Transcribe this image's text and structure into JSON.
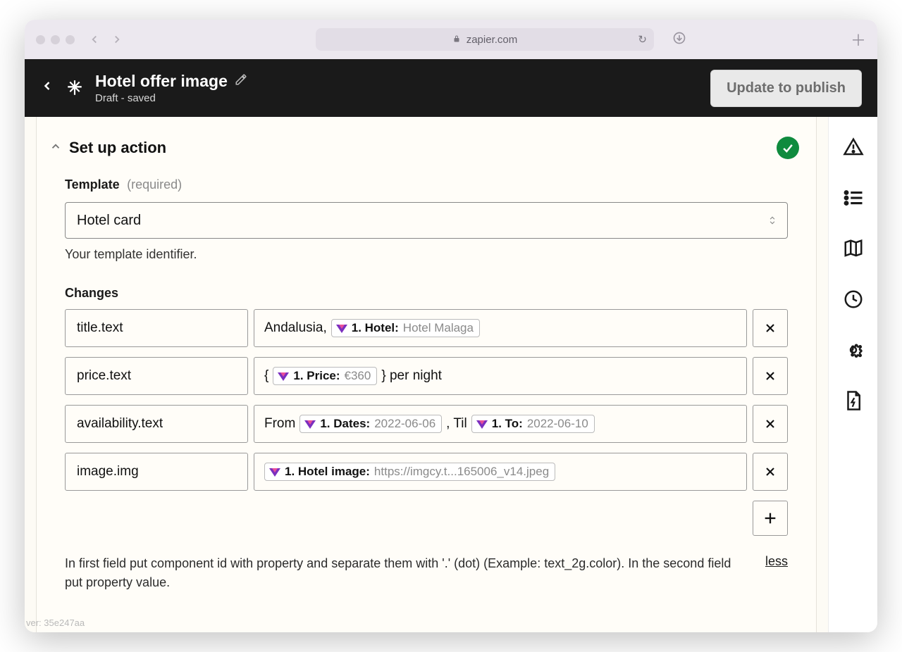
{
  "browser": {
    "domain": "zapier.com"
  },
  "header": {
    "title": "Hotel offer image",
    "status": "Draft - saved",
    "publish_label": "Update to publish"
  },
  "section": {
    "title": "Set up action"
  },
  "template_field": {
    "label": "Template",
    "required_label": "(required)",
    "value": "Hotel card",
    "helper": "Your template identifier."
  },
  "changes": {
    "label": "Changes",
    "rows": [
      {
        "key": "title.text",
        "prefix": "Andalusia,",
        "pills": [
          {
            "label": "1. Hotel:",
            "value": "Hotel Malaga"
          }
        ],
        "mid1": "",
        "mid2": "",
        "suffix": ""
      },
      {
        "key": "price.text",
        "prefix": "{",
        "pills": [
          {
            "label": "1. Price:",
            "value": "€360"
          }
        ],
        "mid1": "",
        "mid2": "",
        "suffix": "} per night"
      },
      {
        "key": "availability.text",
        "prefix": "From",
        "pills": [
          {
            "label": "1. Dates:",
            "value": "2022-06-06"
          },
          {
            "label": "1. To:",
            "value": "2022-06-10"
          }
        ],
        "mid1": ", Til",
        "mid2": "",
        "suffix": ""
      },
      {
        "key": "image.img",
        "prefix": "",
        "pills": [
          {
            "label": "1. Hotel image:",
            "value": "https://imgcy.t...165006_v14.jpeg"
          }
        ],
        "mid1": "",
        "mid2": "",
        "suffix": ""
      }
    ],
    "help_text": "In first field put component id with property and separate them with '.' (dot) (Example: text_2g.color). In the second field put property value.",
    "less_label": "less"
  },
  "footer": {
    "version_prefix": "ver:",
    "version": "35e247aa"
  }
}
